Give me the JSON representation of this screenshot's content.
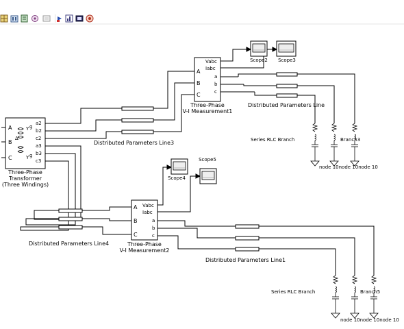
{
  "toolbar": {
    "icons": [
      "grid-icon",
      "library-icon",
      "book-icon",
      "refresh-icon",
      "model-icon",
      "debug-icon",
      "chart-icon",
      "table-icon",
      "target-icon"
    ]
  },
  "blocks": {
    "transformer": {
      "title": "Three-Phase",
      "sub1": "Transformer",
      "sub2": "(Three Windings)",
      "ports_left": [
        "A",
        "B",
        "C"
      ],
      "ports_right": [
        "a2",
        "b2",
        "c2",
        "a3",
        "b3",
        "c3"
      ]
    },
    "vi1": {
      "title": "Three-Phase",
      "sub": "V-I Measurement1",
      "ports_left": [
        "A",
        "B",
        "C"
      ],
      "ports_right": [
        "Vabc",
        "Iabc",
        "a",
        "b",
        "c"
      ]
    },
    "vi2": {
      "title": "Three-Phase",
      "sub": "V-I Measurement2",
      "ports_left": [
        "A",
        "B",
        "C"
      ],
      "ports_right": [
        "Vabc",
        "Iabc",
        "a",
        "b",
        "c"
      ]
    },
    "scope2": "Scope2",
    "scope3": "Scope3",
    "scope4": "Scope4",
    "scope5": "Scope5",
    "dpl": "Distributed Parameters Line",
    "dpl1": "Distributed Parameters Line1",
    "dpl3": "Distributed Parameters Line3",
    "dpl4": "Distributed Parameters Line4",
    "branch_top": {
      "left": "Series RLC Branch",
      "right": "Branch3"
    },
    "branch_bot": {
      "left": "Series RLC Branch",
      "right": "Branch5"
    },
    "node_top": "node 10node 10node 10",
    "node_bot": "node 10node 10node 10"
  }
}
